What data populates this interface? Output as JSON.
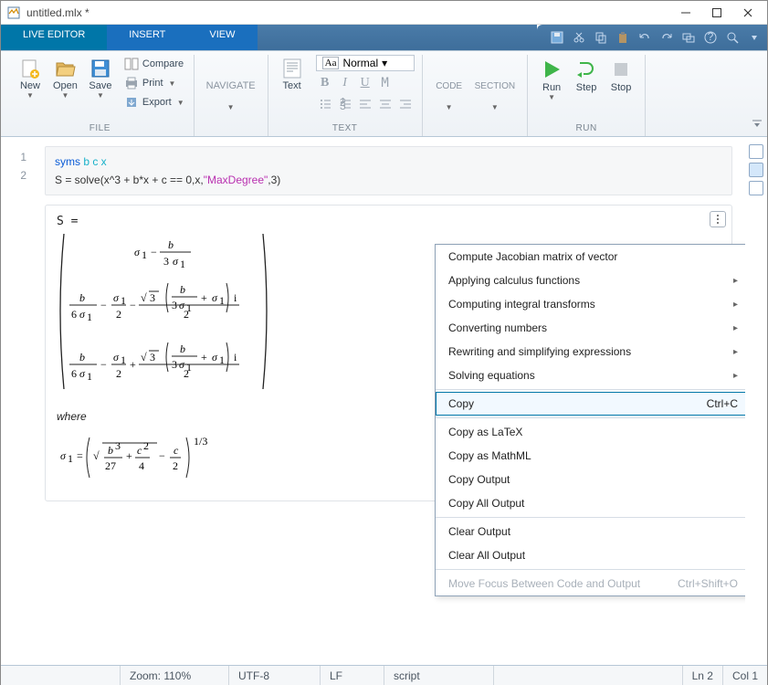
{
  "title": "untitled.mlx *",
  "tabs": {
    "live_editor": "LIVE EDITOR",
    "insert": "INSERT",
    "view": "VIEW"
  },
  "tool": {
    "new": "New",
    "open": "Open",
    "save": "Save",
    "compare": "Compare",
    "print": "Print",
    "export": "Export",
    "file_group": "FILE",
    "navigate": "NAVIGATE",
    "text_btn": "Text",
    "normal": "Normal",
    "text_group": "TEXT",
    "code": "CODE",
    "section": "SECTION",
    "run": "Run",
    "step": "Step",
    "stop": "Stop",
    "run_group": "RUN"
  },
  "line_numbers": [
    "1",
    "2"
  ],
  "code": {
    "l1_a": "syms ",
    "l1_b": "b c x",
    "l2_a": "S = solve(x^3 + b*x + c == 0,x,",
    "l2_str": "\"MaxDegree\"",
    "l2_b": ",3)"
  },
  "output": {
    "s_eq": "S = ",
    "where": "where"
  },
  "context_menu": {
    "items": [
      "Compute Jacobian matrix of vector",
      "Applying calculus functions",
      "Computing integral transforms",
      "Converting numbers",
      "Rewriting and simplifying expressions",
      "Solving equations",
      "Copy",
      "Copy as LaTeX",
      "Copy as MathML",
      "Copy Output",
      "Copy All Output",
      "Clear Output",
      "Clear All Output",
      "Move Focus Between Code and Output"
    ],
    "shortcut_copy": "Ctrl+C",
    "shortcut_move": "Ctrl+Shift+O"
  },
  "status": {
    "zoom": "Zoom: 110%",
    "enc": "UTF-8",
    "eol": "LF",
    "mode": "script",
    "ln": "Ln  2",
    "col": "Col  1"
  }
}
